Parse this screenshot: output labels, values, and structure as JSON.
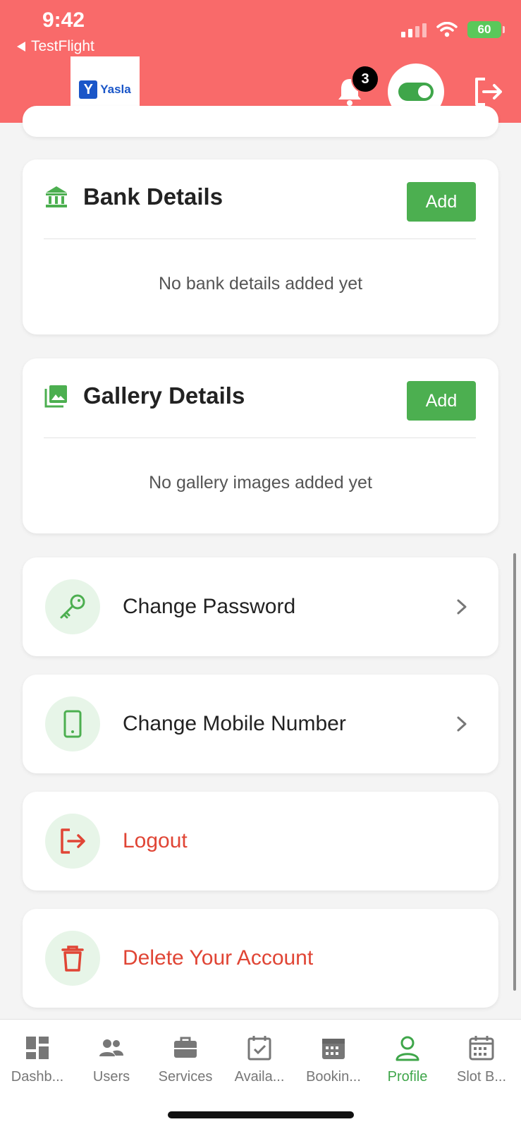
{
  "status": {
    "time": "9:42",
    "back_app": "TestFlight",
    "battery": "60"
  },
  "header": {
    "logo_letter": "Y",
    "logo_text": "Yasla",
    "notification_count": "3"
  },
  "bank": {
    "title": "Bank Details",
    "add_label": "Add",
    "empty": "No bank details added yet"
  },
  "gallery": {
    "title": "Gallery Details",
    "add_label": "Add",
    "empty": "No gallery images added yet"
  },
  "actions": {
    "change_password": "Change Password",
    "change_mobile": "Change Mobile Number",
    "logout": "Logout",
    "delete_account": "Delete Your Account"
  },
  "nav": {
    "items": [
      {
        "label": "Dashb...",
        "icon": "dashboard-icon"
      },
      {
        "label": "Users",
        "icon": "users-icon"
      },
      {
        "label": "Services",
        "icon": "briefcase-icon"
      },
      {
        "label": "Availa...",
        "icon": "calendar-check-icon"
      },
      {
        "label": "Bookin...",
        "icon": "calendar-icon"
      },
      {
        "label": "Profile",
        "icon": "person-icon"
      },
      {
        "label": "Slot B...",
        "icon": "calendar-grid-icon"
      }
    ],
    "active": "Profile"
  },
  "colors": {
    "header": "#f96a6a",
    "accent_green": "#4caf50",
    "danger": "#e04535",
    "icon_bg": "#e7f5e8"
  }
}
